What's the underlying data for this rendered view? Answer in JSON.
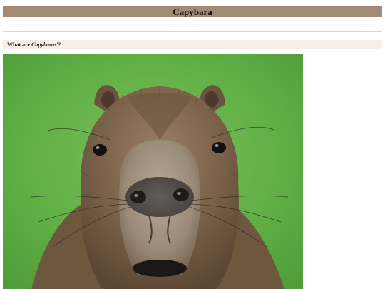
{
  "header": {
    "title": "Capybara"
  },
  "question": {
    "prefix": "What are ",
    "subject": "Capybaras",
    "suffix": "'?"
  },
  "image": {
    "subject": "capybara face close-up photo"
  },
  "colors": {
    "title_bar": "#a48b74",
    "question_bar": "#f5efea",
    "photo_background": "#5fae43"
  }
}
